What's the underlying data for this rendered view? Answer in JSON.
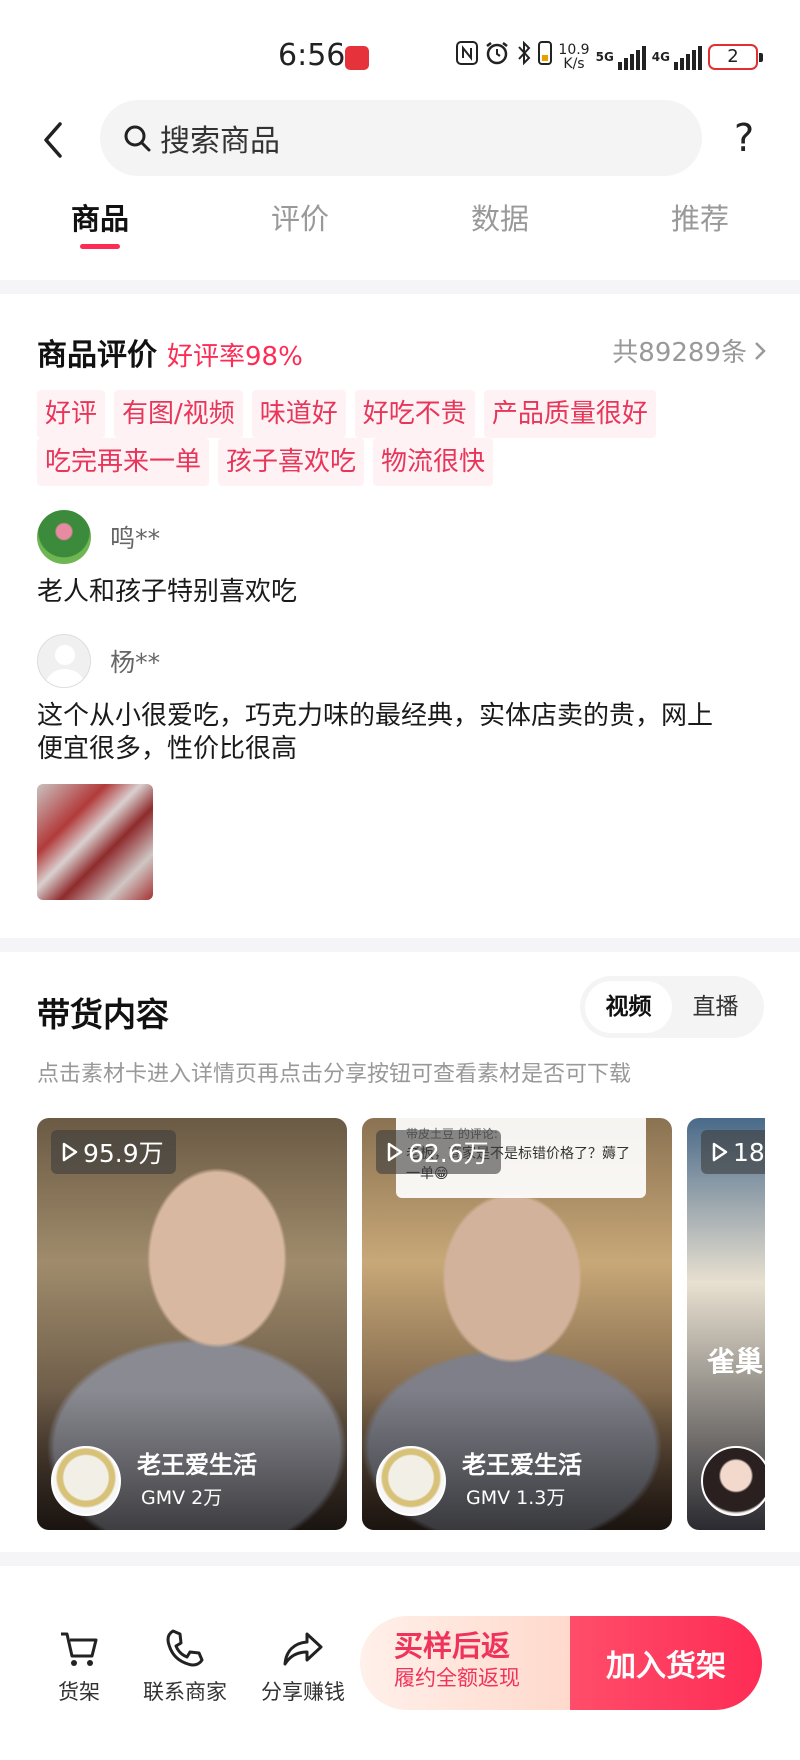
{
  "status_bar": {
    "time": "6:56",
    "net_speed_value": "10.9",
    "net_speed_unit": "K/s",
    "net_1": "5G",
    "net_2": "4G",
    "battery": "2"
  },
  "header": {
    "search_placeholder": "搜索商品",
    "help": "?"
  },
  "tabs": [
    {
      "label": "商品",
      "active": true
    },
    {
      "label": "评价",
      "active": false
    },
    {
      "label": "数据",
      "active": false
    },
    {
      "label": "推荐",
      "active": false
    }
  ],
  "reviews": {
    "title": "商品评价",
    "positive_rate": "好评率98%",
    "total": "共89289条",
    "tags_row1": [
      "好评",
      "有图/视频",
      "味道好",
      "好吃不贵",
      "产品质量很好"
    ],
    "tags_row2": [
      "吃完再来一单",
      "孩子喜欢吃",
      "物流很快"
    ],
    "items": [
      {
        "name": "鸣**",
        "text": "老人和孩子特别喜欢吃"
      },
      {
        "name": "杨**",
        "text_line1": "这个从小很爱吃，巧克力味的最经典，实体店卖的贵，网上",
        "text_line2": "便宜很多，性价比很高"
      }
    ]
  },
  "content": {
    "title": "带货内容",
    "segments": [
      {
        "label": "视频",
        "active": true
      },
      {
        "label": "直播",
        "active": false
      }
    ],
    "hint": "点击素材卡进入详情页再点击分享按钮可查看素材是否可下载",
    "cards": [
      {
        "views": "95.9万",
        "author": "老王爱生活",
        "gmv": "GMV 2万"
      },
      {
        "views": "62.6万",
        "author": "老王爱生活",
        "gmv": "GMV 1.3万",
        "comment_head": "带皮土豆 的评论:",
        "comment_body": "老板，商家是不是标错价格了？薅了一单😁"
      },
      {
        "views": "18",
        "overlay_text": "雀巢"
      }
    ]
  },
  "bottom_bar": {
    "shelf": "货架",
    "contact": "联系商家",
    "share": "分享赚钱",
    "sample_main": "买样后返",
    "sample_sub": "履约全额返现",
    "add_to_shelf": "加入货架"
  }
}
